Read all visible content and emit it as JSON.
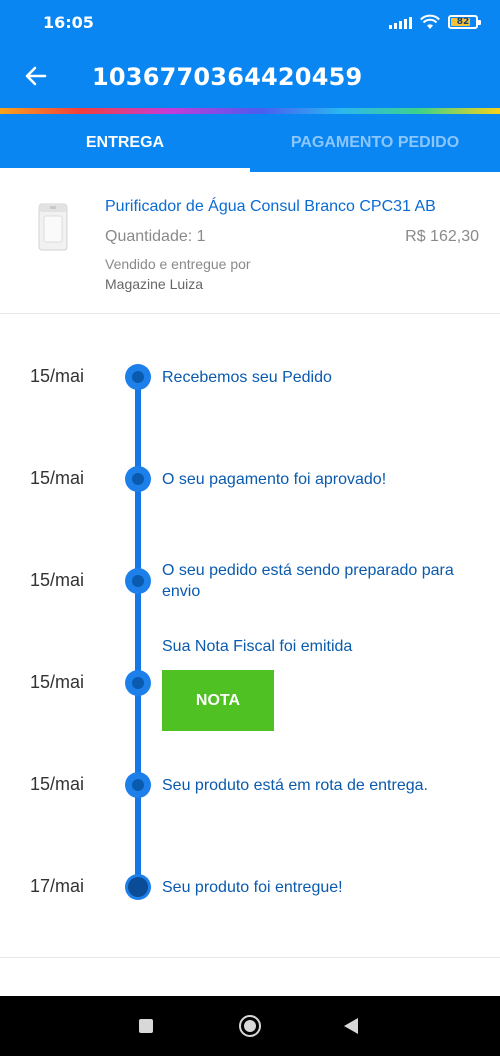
{
  "status_bar": {
    "time": "16:05",
    "battery": "82",
    "battery_level": 0.82,
    "icons": [
      "signal-icon",
      "wifi-icon",
      "battery-icon"
    ]
  },
  "app_bar": {
    "title": "1036770364420459",
    "back_icon": "arrow-left-icon"
  },
  "tabs": [
    {
      "label": "ENTREGA",
      "active": true
    },
    {
      "label": "PAGAMENTO PEDIDO",
      "active": false
    }
  ],
  "product": {
    "name": "Purificador de Água Consul Branco CPC31 AB",
    "quantity": "Quantidade: 1",
    "price": "R$ 162,30",
    "sold_by_label": "Vendido e entregue por",
    "seller": "Magazine Luiza"
  },
  "timeline": [
    {
      "date": "15/mai",
      "text": "Recebemos seu Pedido"
    },
    {
      "date": "15/mai",
      "text": "O seu pagamento foi aprovado!"
    },
    {
      "date": "15/mai",
      "text": "O seu pedido está sendo preparado para envio"
    },
    {
      "date": "15/mai",
      "text": "Sua Nota Fiscal foi emitida",
      "button": "NOTA"
    },
    {
      "date": "15/mai",
      "text": "Seu produto está em rota de entrega."
    },
    {
      "date": "17/mai",
      "text": "Seu produto foi entregue!"
    }
  ],
  "colors": {
    "primary": "#0a86f2",
    "link": "#0a6bd3",
    "timeline": "#1577e6",
    "nota_button": "#4fc122"
  },
  "nav_bar": {
    "icons": [
      "recent-apps-icon",
      "home-icon",
      "back-icon"
    ]
  }
}
